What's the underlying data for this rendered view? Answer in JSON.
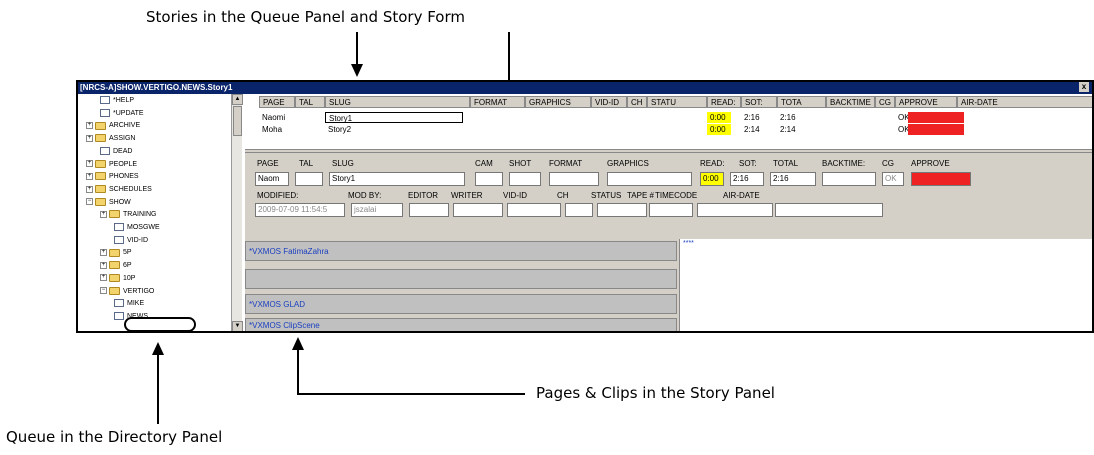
{
  "callouts": {
    "top": "Stories in the Queue Panel and Story Form",
    "story_panel": "Pages & Clips in the Story Panel",
    "directory": "Queue in the Directory Panel"
  },
  "window": {
    "title": "[NRCS-A]SHOW.VERTIGO.NEWS.Story1",
    "close_label": "x"
  },
  "directory": {
    "items": [
      {
        "label": "*HELP",
        "type": "doc"
      },
      {
        "label": "*UPDATE",
        "type": "doc"
      },
      {
        "label": "ARCHIVE",
        "type": "folder"
      },
      {
        "label": "ASSIGN",
        "type": "folder"
      },
      {
        "label": "DEAD",
        "type": "doc"
      },
      {
        "label": "PEOPLE",
        "type": "folder"
      },
      {
        "label": "PHONES",
        "type": "folder"
      },
      {
        "label": "SCHEDULES",
        "type": "folder"
      },
      {
        "label": "SHOW",
        "type": "folder"
      },
      {
        "label": "TRAINING",
        "type": "folder"
      },
      {
        "label": "MOSGWE",
        "type": "doc"
      },
      {
        "label": "VID-ID",
        "type": "doc"
      },
      {
        "label": "5P",
        "type": "folder"
      },
      {
        "label": "6P",
        "type": "folder"
      },
      {
        "label": "10P",
        "type": "folder"
      },
      {
        "label": "VERTIGO",
        "type": "folder"
      },
      {
        "label": "MIKE",
        "type": "doc"
      },
      {
        "label": "NEWS",
        "type": "doc"
      }
    ]
  },
  "queue": {
    "headers": [
      "PAGE",
      "TAL",
      "SLUG",
      "FORMAT",
      "GRAPHICS",
      "VID-ID",
      "CH",
      "STATU",
      "READ:",
      "SOT:",
      "TOTA",
      "BACKTIME",
      "CG",
      "APPROVE",
      "AIR-DATE"
    ],
    "rows": [
      {
        "page": "Naomi",
        "slug": "Story1",
        "read": "0:00",
        "sot": "2:16",
        "total": "2:16",
        "cg": "OK"
      },
      {
        "page": "Moha",
        "slug": "Story2",
        "read": "0:00",
        "sot": "2:14",
        "total": "2:14",
        "cg": "OK"
      }
    ]
  },
  "form": {
    "row1_labels": [
      "PAGE",
      "TAL",
      "SLUG",
      "CAM",
      "SHOT",
      "FORMAT",
      "GRAPHICS",
      "READ:",
      "SOT:",
      "TOTAL",
      "BACKTIME:",
      "CG",
      "APPROVE"
    ],
    "page_value": "Naom",
    "slug_value": "Story1",
    "read_value": "0:00",
    "sot_value": "2:16",
    "total_value": "2:16",
    "cg_value": "OK",
    "row2_labels": [
      "MODIFIED:",
      "MOD BY:",
      "EDITOR",
      "WRITER",
      "VID-ID",
      "CH",
      "STATUS",
      "TAPE #",
      "TIMECODE",
      "AIR-DATE"
    ],
    "modified_value": "2009-07-09 11:54:5",
    "modby_value": "jszalai"
  },
  "story_panel": {
    "pages": [
      "*VXMOS FatimaZahra",
      "",
      "*VXMOS GLAD",
      "*VXMOS ClipScene"
    ],
    "text_marker": "****"
  },
  "colors": {
    "titlebar": "#0a246a",
    "read_highlight": "#ffff00",
    "approve_red": "#ee2222",
    "mos_text": "#1a3fc0"
  }
}
